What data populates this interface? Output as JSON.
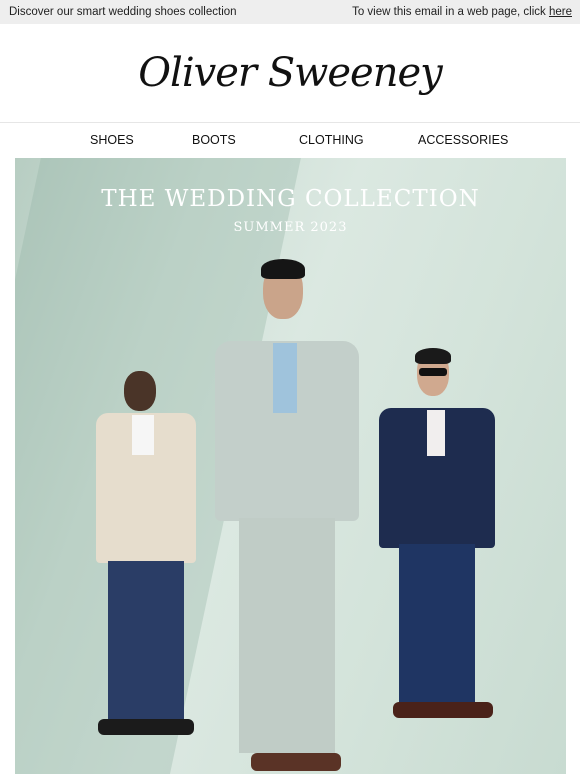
{
  "preheader": {
    "left_text": "Discover our smart wedding shoes collection",
    "right_text": "To view this email in a web page, click ",
    "right_link": "here"
  },
  "brand": {
    "logo_text": "Oliver Sweeney"
  },
  "nav": {
    "items": [
      "SHOES",
      "BOOTS",
      "CLOTHING",
      "ACCESSORIES"
    ]
  },
  "hero": {
    "title": "THE WEDDING COLLECTION",
    "subtitle": "SUMMER 2023",
    "image_description_icon": "three-models-photo"
  },
  "colors": {
    "hero_bg": "#d3e3da",
    "preheader_bg": "#eeeeee"
  }
}
